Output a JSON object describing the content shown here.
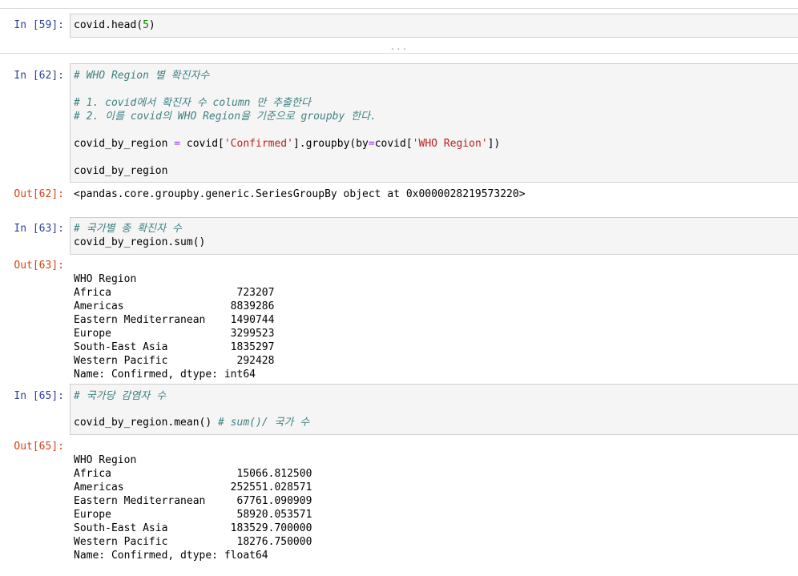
{
  "cells": {
    "c59": {
      "prompt": "In [59]:",
      "code": [
        "covid.head(",
        "5",
        ")"
      ]
    },
    "collapsed": "...",
    "c62": {
      "prompt": "In [62]:",
      "comment1": "# WHO Region 별 확진자수",
      "comment2": "# 1. covid에서 확진자 수 column 만 추출한다",
      "comment3": "# 2. 이를 covid의 WHO Region을 기준으로 groupby 한다.",
      "code_a": "covid_by_region ",
      "code_eq": "=",
      "code_b": " covid[",
      "code_str1": "'Confirmed'",
      "code_c": "].groupby(by",
      "code_eq2": "=",
      "code_d": "covid[",
      "code_str2": "'WHO Region'",
      "code_e": "])",
      "code_last": "covid_by_region",
      "out_prompt": "Out[62]:",
      "output": "<pandas.core.groupby.generic.SeriesGroupBy object at 0x0000028219573220>"
    },
    "c63": {
      "prompt": "In [63]:",
      "comment": "# 국가별 총 확진자 수",
      "code": "covid_by_region.sum()",
      "out_prompt": "Out[63]:",
      "output": [
        "WHO Region",
        "Africa                    723207",
        "Americas                 8839286",
        "Eastern Mediterranean    1490744",
        "Europe                   3299523",
        "South-East Asia          1835297",
        "Western Pacific           292428",
        "Name: Confirmed, dtype: int64"
      ]
    },
    "c65": {
      "prompt": "In [65]:",
      "comment": "# 국가당 감염자 수",
      "code": "covid_by_region.mean() ",
      "code_comment": "# sum()/ 국가 수",
      "out_prompt": "Out[65]:",
      "output": [
        "WHO Region",
        "Africa                    15066.812500",
        "Americas                 252551.028571",
        "Eastern Mediterranean     67761.090909",
        "Europe                    58920.053571",
        "South-East Asia          183529.700000",
        "Western Pacific           18276.750000",
        "Name: Confirmed, dtype: float64"
      ]
    }
  },
  "colors": {
    "in_prompt": "#303f9f",
    "out_prompt": "#d84315",
    "comment": "#408080",
    "string": "#ba2121",
    "number": "#008800",
    "operator": "#aa22ff",
    "cell_bg": "#f5f5f5"
  }
}
